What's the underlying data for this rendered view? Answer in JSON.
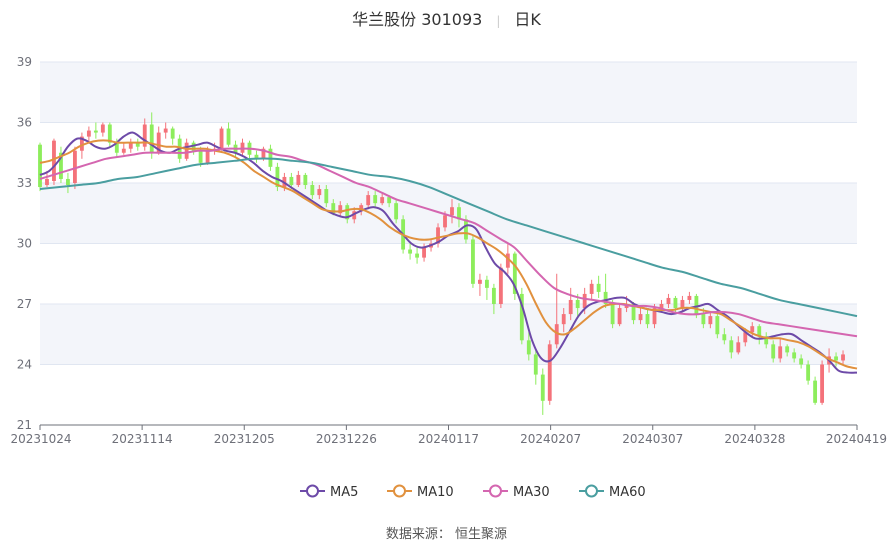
{
  "title": {
    "stock": "华兰股份 301093",
    "period": "日K"
  },
  "source_label": "数据来源：  恒生聚源",
  "colors": {
    "up": "#f4727a",
    "down": "#8ded5c",
    "band": "#f3f5fa",
    "grid": "#e0e6f1",
    "ma5": "#6d4aa8",
    "ma10": "#e1913e",
    "ma30": "#d466b0",
    "ma60": "#4a9ea0"
  },
  "chart_data": {
    "type": "candlestick",
    "ylim": [
      21,
      39
    ],
    "yticks": [
      21,
      24,
      27,
      30,
      33,
      36,
      39
    ],
    "date_range": [
      "20231024",
      "20240419"
    ],
    "xticks": [
      "20231024",
      "20231114",
      "20231205",
      "20231226",
      "20240117",
      "20240207",
      "20240307",
      "20240328",
      "20240419"
    ],
    "trading_days": 118,
    "legend_position": "bottom",
    "legend": [
      {
        "name": "MA5",
        "color": "#6d4aa8"
      },
      {
        "name": "MA10",
        "color": "#e1913e"
      },
      {
        "name": "MA30",
        "color": "#d466b0"
      },
      {
        "name": "MA60",
        "color": "#4a9ea0"
      }
    ],
    "ma": [
      {
        "name": "MA5",
        "values": [
          33.4,
          33.6,
          34.1,
          34.8,
          35.2,
          35.1,
          34.8,
          34.7,
          34.9,
          35.3,
          35.5,
          35.2,
          34.9,
          34.6,
          34.5,
          34.7,
          34.8,
          34.9,
          35.0,
          34.8,
          34.6,
          34.5,
          34.3,
          34.0,
          33.6,
          33.3,
          33.1,
          32.8,
          32.5,
          32.2,
          31.9,
          31.6,
          31.4,
          31.3,
          31.5,
          31.7,
          31.8,
          31.6,
          31.0,
          30.5,
          30.0,
          29.8,
          29.9,
          30.1,
          30.4,
          30.6,
          30.9,
          30.7,
          29.8,
          29.0,
          28.6,
          28.0,
          26.8,
          25.2,
          24.3,
          24.2,
          24.8,
          25.6,
          26.4,
          26.9,
          27.1,
          27.2,
          27.3,
          27.3,
          27.0,
          26.8,
          26.7,
          26.6,
          26.5,
          26.6,
          26.8,
          26.9,
          27.0,
          26.7,
          26.4,
          26.0,
          25.6,
          25.3,
          25.3,
          25.4,
          25.5,
          25.5,
          25.2,
          24.9,
          24.6,
          24.2,
          23.7,
          23.6,
          23.6
        ]
      },
      {
        "name": "MA10",
        "values": [
          34.0,
          34.1,
          34.3,
          34.5,
          34.8,
          35.0,
          35.1,
          35.1,
          35.0,
          35.0,
          35.0,
          35.0,
          34.9,
          34.8,
          34.8,
          34.7,
          34.7,
          34.7,
          34.6,
          34.5,
          34.3,
          34.0,
          33.6,
          33.3,
          33.0,
          32.8,
          32.6,
          32.3,
          32.0,
          31.7,
          31.6,
          31.6,
          31.7,
          31.7,
          31.5,
          31.2,
          30.8,
          30.5,
          30.3,
          30.2,
          30.2,
          30.3,
          30.4,
          30.5,
          30.5,
          30.3,
          30.0,
          29.7,
          29.3,
          28.8,
          28.0,
          27.0,
          26.1,
          25.6,
          25.5,
          25.8,
          26.2,
          26.6,
          26.9,
          27.0,
          27.0,
          26.9,
          26.8,
          26.7,
          26.7,
          26.7,
          26.8,
          26.8,
          26.7,
          26.6,
          26.5,
          26.2,
          25.9,
          25.6,
          25.4,
          25.3,
          25.3,
          25.2,
          25.1,
          24.9,
          24.6,
          24.3,
          24.1,
          23.9,
          23.8
        ]
      },
      {
        "name": "MA30",
        "values": [
          33.2,
          33.4,
          33.6,
          33.8,
          34.0,
          34.2,
          34.3,
          34.4,
          34.5,
          34.5,
          34.5,
          34.5,
          34.6,
          34.6,
          34.7,
          34.7,
          34.7,
          34.6,
          34.4,
          34.3,
          34.1,
          33.9,
          33.6,
          33.3,
          33.0,
          32.8,
          32.5,
          32.2,
          32.0,
          31.8,
          31.6,
          31.4,
          31.2,
          31.0,
          30.6,
          30.2,
          29.8,
          29.1,
          28.4,
          27.8,
          27.5,
          27.3,
          27.2,
          27.1,
          27.0,
          26.9,
          26.9,
          26.8,
          26.6,
          26.5,
          26.5,
          26.6,
          26.6,
          26.5,
          26.3,
          26.1,
          26.0,
          25.9,
          25.8,
          25.7,
          25.6,
          25.5,
          25.4
        ]
      },
      {
        "name": "MA60",
        "values": [
          32.7,
          32.8,
          32.9,
          33.0,
          33.2,
          33.3,
          33.5,
          33.7,
          33.9,
          34.0,
          34.1,
          34.2,
          34.2,
          34.1,
          34.0,
          33.8,
          33.6,
          33.4,
          33.3,
          33.1,
          32.8,
          32.4,
          32.0,
          31.6,
          31.2,
          30.9,
          30.6,
          30.3,
          30.0,
          29.7,
          29.4,
          29.1,
          28.8,
          28.6,
          28.3,
          28.0,
          27.8,
          27.5,
          27.2,
          27.0,
          26.8,
          26.6,
          26.4
        ]
      }
    ],
    "candles": [
      [
        34.9,
        32.8,
        35.0,
        32.6
      ],
      [
        32.9,
        33.2,
        33.6,
        32.8
      ],
      [
        33.1,
        35.1,
        35.2,
        32.9
      ],
      [
        34.5,
        33.2,
        34.8,
        33.0
      ],
      [
        33.2,
        32.9,
        33.5,
        32.5
      ],
      [
        33.0,
        34.6,
        34.8,
        32.7
      ],
      [
        34.6,
        35.3,
        35.5,
        34.2
      ],
      [
        35.3,
        35.6,
        35.8,
        35.0
      ],
      [
        35.6,
        35.5,
        36.0,
        35.2
      ],
      [
        35.5,
        35.9,
        36.0,
        35.3
      ],
      [
        35.9,
        35.0,
        36.0,
        34.8
      ],
      [
        35.0,
        34.5,
        35.2,
        34.3
      ],
      [
        34.5,
        34.7,
        35.0,
        34.4
      ],
      [
        34.7,
        35.0,
        35.2,
        34.5
      ],
      [
        35.0,
        34.8,
        35.2,
        34.6
      ],
      [
        34.8,
        35.9,
        36.2,
        34.6
      ],
      [
        35.9,
        34.5,
        36.5,
        34.2
      ],
      [
        34.5,
        35.5,
        35.8,
        34.4
      ],
      [
        35.5,
        35.7,
        36.0,
        35.2
      ],
      [
        35.7,
        35.2,
        35.8,
        34.9
      ],
      [
        35.2,
        34.2,
        35.4,
        34.0
      ],
      [
        34.2,
        35.0,
        35.2,
        34.1
      ],
      [
        35.0,
        34.6,
        35.1,
        34.4
      ],
      [
        34.6,
        34.0,
        34.8,
        33.8
      ],
      [
        34.0,
        34.6,
        34.8,
        33.9
      ],
      [
        34.6,
        34.7,
        35.0,
        34.4
      ],
      [
        34.7,
        35.7,
        35.8,
        34.6
      ],
      [
        35.7,
        34.9,
        36.0,
        34.8
      ],
      [
        34.9,
        34.5,
        35.1,
        34.3
      ],
      [
        34.5,
        35.0,
        35.2,
        34.3
      ],
      [
        35.0,
        34.4,
        35.1,
        34.2
      ],
      [
        34.4,
        34.2,
        34.6,
        34.0
      ],
      [
        34.2,
        34.7,
        34.8,
        34.1
      ],
      [
        34.7,
        33.8,
        34.9,
        33.6
      ],
      [
        33.8,
        32.8,
        34.0,
        32.6
      ],
      [
        32.8,
        33.3,
        33.5,
        32.6
      ],
      [
        33.3,
        32.9,
        33.5,
        32.7
      ],
      [
        32.9,
        33.4,
        33.6,
        32.8
      ],
      [
        33.4,
        32.9,
        33.5,
        32.7
      ],
      [
        32.9,
        32.4,
        33.1,
        32.2
      ],
      [
        32.4,
        32.7,
        32.9,
        32.2
      ],
      [
        32.7,
        32.0,
        32.9,
        31.8
      ],
      [
        32.0,
        31.5,
        32.2,
        31.4
      ],
      [
        31.5,
        31.9,
        32.1,
        31.3
      ],
      [
        31.9,
        31.2,
        32.0,
        31.0
      ],
      [
        31.2,
        31.6,
        31.8,
        31.0
      ],
      [
        31.6,
        31.9,
        32.0,
        31.4
      ],
      [
        31.9,
        32.4,
        32.6,
        31.7
      ],
      [
        32.4,
        32.0,
        32.6,
        31.8
      ],
      [
        32.0,
        32.3,
        32.5,
        31.9
      ],
      [
        32.3,
        32.0,
        32.4,
        31.8
      ],
      [
        32.0,
        31.2,
        32.2,
        31.0
      ],
      [
        31.2,
        29.7,
        31.4,
        29.5
      ],
      [
        29.7,
        29.5,
        30.0,
        29.2
      ],
      [
        29.5,
        29.3,
        29.8,
        29.0
      ],
      [
        29.3,
        29.8,
        30.0,
        29.1
      ],
      [
        29.8,
        30.0,
        30.2,
        29.6
      ],
      [
        30.0,
        30.8,
        31.0,
        29.8
      ],
      [
        30.8,
        31.4,
        31.6,
        30.6
      ],
      [
        31.4,
        31.8,
        32.2,
        31.0
      ],
      [
        31.8,
        31.2,
        32.0,
        30.8
      ],
      [
        31.2,
        30.2,
        31.4,
        30.0
      ],
      [
        30.2,
        28.0,
        30.4,
        27.8
      ],
      [
        28.0,
        28.2,
        28.5,
        27.4
      ],
      [
        28.2,
        27.8,
        28.4,
        27.2
      ],
      [
        27.8,
        27.0,
        28.0,
        26.5
      ],
      [
        27.0,
        28.8,
        29.0,
        26.8
      ],
      [
        28.8,
        29.5,
        30.0,
        28.5
      ],
      [
        29.5,
        27.5,
        29.6,
        27.2
      ],
      [
        27.5,
        25.2,
        27.8,
        25.0
      ],
      [
        25.2,
        24.5,
        25.6,
        24.2
      ],
      [
        24.5,
        23.5,
        24.8,
        23.0
      ],
      [
        23.5,
        22.2,
        23.8,
        21.5
      ],
      [
        22.2,
        25.0,
        25.2,
        22.0
      ],
      [
        25.0,
        26.0,
        28.5,
        24.8
      ],
      [
        26.0,
        26.5,
        26.8,
        25.6
      ],
      [
        26.5,
        27.2,
        27.8,
        26.2
      ],
      [
        27.2,
        26.8,
        27.5,
        26.4
      ],
      [
        26.8,
        27.5,
        27.8,
        26.5
      ],
      [
        27.5,
        28.0,
        28.2,
        27.2
      ],
      [
        28.0,
        27.6,
        28.4,
        27.3
      ],
      [
        27.6,
        27.0,
        28.5,
        26.8
      ],
      [
        27.0,
        26.0,
        27.2,
        25.8
      ],
      [
        26.0,
        26.8,
        27.0,
        25.9
      ],
      [
        26.8,
        27.0,
        27.4,
        26.6
      ],
      [
        27.0,
        26.2,
        27.1,
        26.0
      ],
      [
        26.2,
        26.5,
        26.8,
        26.0
      ],
      [
        26.5,
        26.0,
        26.7,
        25.8
      ],
      [
        26.0,
        26.8,
        27.0,
        25.8
      ],
      [
        26.8,
        27.0,
        27.2,
        26.6
      ],
      [
        27.0,
        27.3,
        27.5,
        26.8
      ],
      [
        27.3,
        26.8,
        27.4,
        26.5
      ],
      [
        26.8,
        27.2,
        27.4,
        26.6
      ],
      [
        27.2,
        27.4,
        27.6,
        27.0
      ],
      [
        27.4,
        26.5,
        27.5,
        26.3
      ],
      [
        26.5,
        26.0,
        26.8,
        25.8
      ],
      [
        26.0,
        26.4,
        26.6,
        25.8
      ],
      [
        26.4,
        25.5,
        26.6,
        25.3
      ],
      [
        25.5,
        25.2,
        25.8,
        25.0
      ],
      [
        25.2,
        24.6,
        25.4,
        24.3
      ],
      [
        24.6,
        25.1,
        25.4,
        24.5
      ],
      [
        25.1,
        25.6,
        25.8,
        24.9
      ],
      [
        25.6,
        25.9,
        26.1,
        25.4
      ],
      [
        25.9,
        25.4,
        26.0,
        25.0
      ],
      [
        25.4,
        25.0,
        25.6,
        24.8
      ],
      [
        25.0,
        24.3,
        25.2,
        24.1
      ],
      [
        24.3,
        24.9,
        25.3,
        24.1
      ],
      [
        24.9,
        24.6,
        25.0,
        24.4
      ],
      [
        24.6,
        24.3,
        24.8,
        24.1
      ],
      [
        24.3,
        24.0,
        24.5,
        23.8
      ],
      [
        24.0,
        23.2,
        24.2,
        23.0
      ],
      [
        23.2,
        22.1,
        23.4,
        22.0
      ],
      [
        22.1,
        24.0,
        24.2,
        22.0
      ],
      [
        24.0,
        24.4,
        24.8,
        23.6
      ],
      [
        24.4,
        24.2,
        24.6,
        23.9
      ],
      [
        24.2,
        24.5,
        24.7,
        24.0
      ]
    ]
  }
}
